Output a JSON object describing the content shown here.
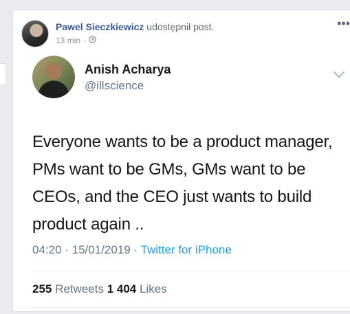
{
  "post": {
    "author": "Pawel Sieczkiewicz",
    "action": "udostępnił post.",
    "time": "13 min",
    "separator": "·",
    "audience_icon": "globe-icon",
    "more_icon": "ellipsis-icon"
  },
  "tweet": {
    "name": "Anish Acharya",
    "handle": "@illscience",
    "text": "Everyone wants to be a product manager, PMs want to be GMs, GMs want to be CEOs, and the CEO just wants to build product again ..",
    "timestamp": "04:20 · 15/01/2019 ·",
    "source": "Twitter for iPhone",
    "retweets_count": "255",
    "retweets_label": "Retweets",
    "likes_count": "1 404",
    "likes_label": "Likes"
  },
  "colors": {
    "link": "#385898",
    "twitter_blue": "#1da1f2",
    "background": "#e9ebee"
  }
}
